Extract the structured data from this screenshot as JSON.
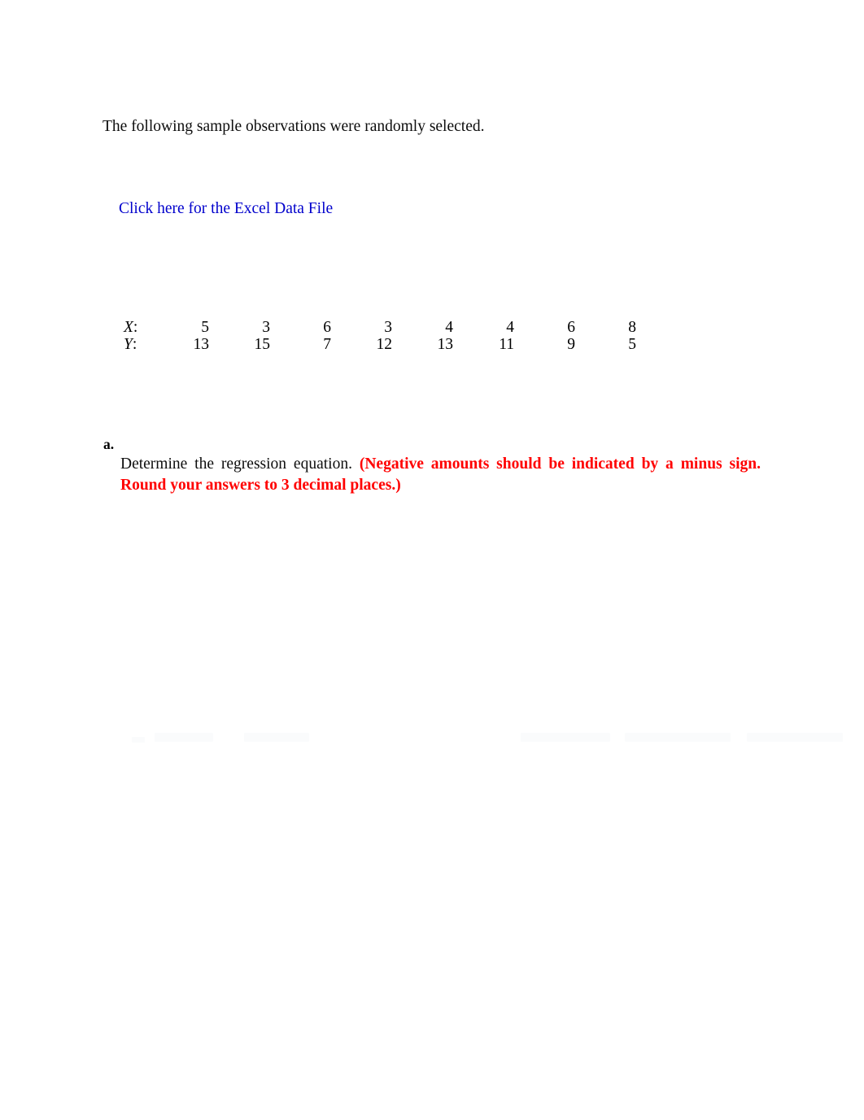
{
  "document": {
    "intro_text": "The following sample observations were randomly selected.",
    "excel_link_label": "Click here for the Excel Data File"
  },
  "data_table": {
    "row_x_label": "X",
    "row_x_colon": ":",
    "row_y_label": "Y",
    "row_y_colon": ":",
    "x_values": [
      "5",
      "3",
      "6",
      "3",
      "4",
      "4",
      "6",
      "8"
    ],
    "y_values": [
      "13",
      "15",
      "7",
      "12",
      "13",
      "11",
      "9",
      "5"
    ]
  },
  "question": {
    "marker": "a.",
    "prompt": "Determine the regression equation. ",
    "note": "(Negative amounts should be indicated by a minus sign. Round your answers to 3 decimal places.)"
  },
  "colors": {
    "link_blue": "#0000cc",
    "note_red": "#ff0000",
    "text_black": "#0d0d0d"
  }
}
